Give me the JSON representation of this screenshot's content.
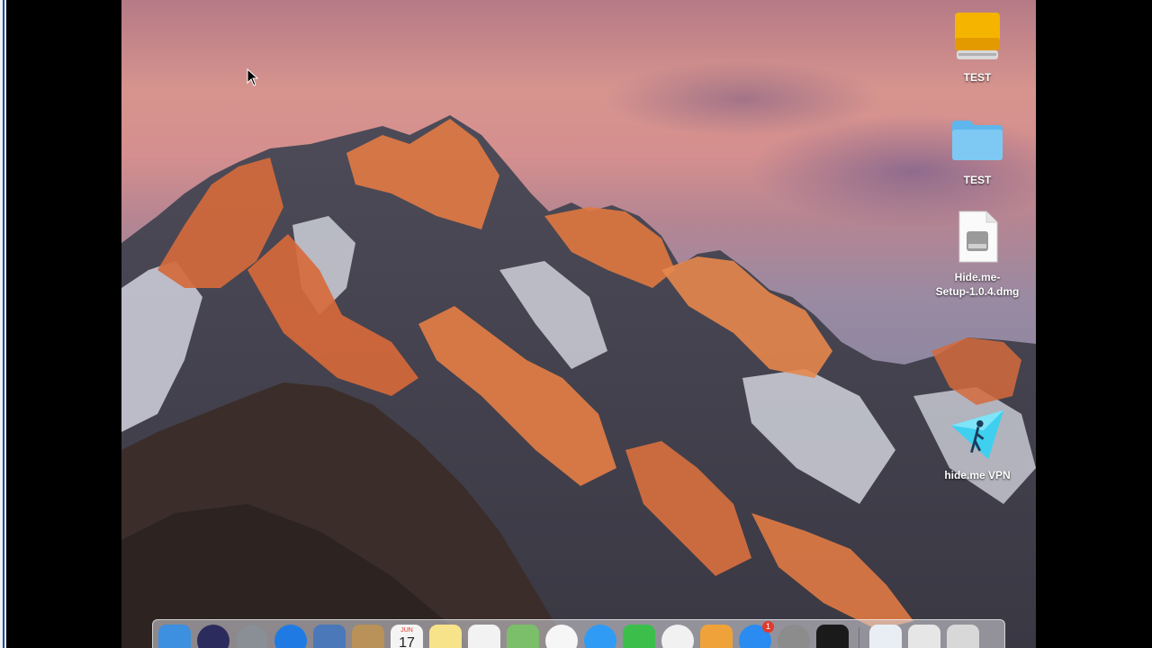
{
  "desktop": {
    "icons": [
      {
        "label": "TEST",
        "kind": "drive-icon"
      },
      {
        "label": "TEST",
        "kind": "folder-icon"
      },
      {
        "label": "Hide.me-\nSetup-1.0.4.dmg",
        "kind": "dmg-file-icon"
      },
      {
        "label": "hide.me VPN",
        "kind": "hideme-app-icon"
      }
    ]
  },
  "dock": {
    "apps": [
      {
        "name": "finder-icon",
        "color": "#3d8fe0"
      },
      {
        "name": "siri-icon",
        "color": "#2b2b5e"
      },
      {
        "name": "launchpad-icon",
        "color": "#8a8f96"
      },
      {
        "name": "safari-icon",
        "color": "#1f7be3"
      },
      {
        "name": "photo-app-icon",
        "color": "#4a78b8"
      },
      {
        "name": "contacts-icon",
        "color": "#b9925a"
      },
      {
        "name": "calendar-icon",
        "color": "#f4f4f4",
        "month": "JUN",
        "day": "17"
      },
      {
        "name": "notes-icon",
        "color": "#f7e38a"
      },
      {
        "name": "reminders-icon",
        "color": "#f2f2f2"
      },
      {
        "name": "maps-icon",
        "color": "#7bbf6a"
      },
      {
        "name": "photos-icon",
        "color": "#f6f6f6"
      },
      {
        "name": "messages-icon",
        "color": "#2f9bf5"
      },
      {
        "name": "facetime-icon",
        "color": "#3bbf4a"
      },
      {
        "name": "itunes-icon",
        "color": "#f1f1f1"
      },
      {
        "name": "ibooks-icon",
        "color": "#f0a23a"
      },
      {
        "name": "app-store-icon",
        "color": "#2a8cf0",
        "badge": "1"
      },
      {
        "name": "system-preferences-icon",
        "color": "#8c8c8c"
      },
      {
        "name": "activity-monitor-icon",
        "color": "#1a1a1a"
      }
    ],
    "right_items": [
      {
        "name": "preview-icon",
        "color": "#e9eef5"
      },
      {
        "name": "downloads-stack-icon",
        "color": "#e6e6e6"
      },
      {
        "name": "trash-icon",
        "color": "#d8d8d8"
      }
    ]
  }
}
